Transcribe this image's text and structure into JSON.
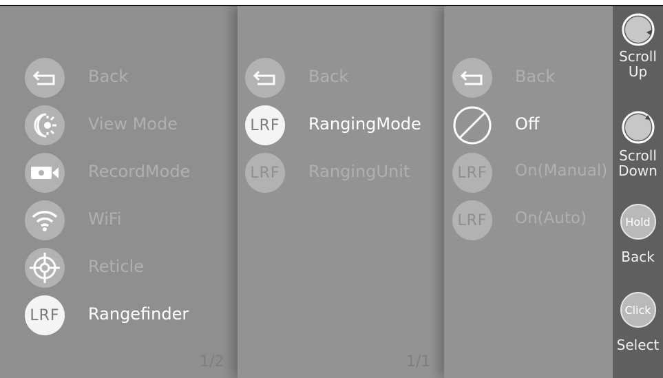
{
  "panel1": {
    "page_indicator": "1/2",
    "items": [
      {
        "label": "Back",
        "icon": "back-arrow-icon",
        "active": false
      },
      {
        "label": "View Mode",
        "icon": "view-mode-icon",
        "active": false
      },
      {
        "label": "RecordMode",
        "icon": "camera-icon",
        "active": false
      },
      {
        "label": "WiFi",
        "icon": "wifi-icon",
        "active": false
      },
      {
        "label": "Reticle",
        "icon": "reticle-icon",
        "active": false
      },
      {
        "label": "Rangefinder",
        "icon_text": "LRF",
        "active": true
      }
    ]
  },
  "panel2": {
    "page_indicator": "1/1",
    "items": [
      {
        "label": "Back",
        "icon": "back-arrow-icon",
        "active": false
      },
      {
        "label": "RangingMode",
        "icon_text": "LRF",
        "active": true
      },
      {
        "label": "RangingUnit",
        "icon_text": "LRF",
        "active": false
      }
    ]
  },
  "panel3": {
    "items": [
      {
        "label": "Back",
        "icon": "back-arrow-icon",
        "active": false
      },
      {
        "label": "Off",
        "icon": "off-icon",
        "active": true
      },
      {
        "label": "On(Manual)",
        "icon_text": "LRF",
        "active": false
      },
      {
        "label": "On(Auto)",
        "icon_text": "LRF",
        "active": false
      }
    ]
  },
  "controls": {
    "scroll_up": "Scroll Up",
    "scroll_up_line1": "Scroll",
    "scroll_up_line2": "Up",
    "scroll_down_line1": "Scroll",
    "scroll_down_line2": "Down",
    "hold_text": "Hold",
    "back_label": "Back",
    "click_text": "Click",
    "select_label": "Select"
  },
  "colors": {
    "panel_bg": "#8f8f8f",
    "sidebar_bg": "#5f5f5f",
    "inactive_text": "#b0b0b0",
    "active_text": "#ffffff"
  }
}
